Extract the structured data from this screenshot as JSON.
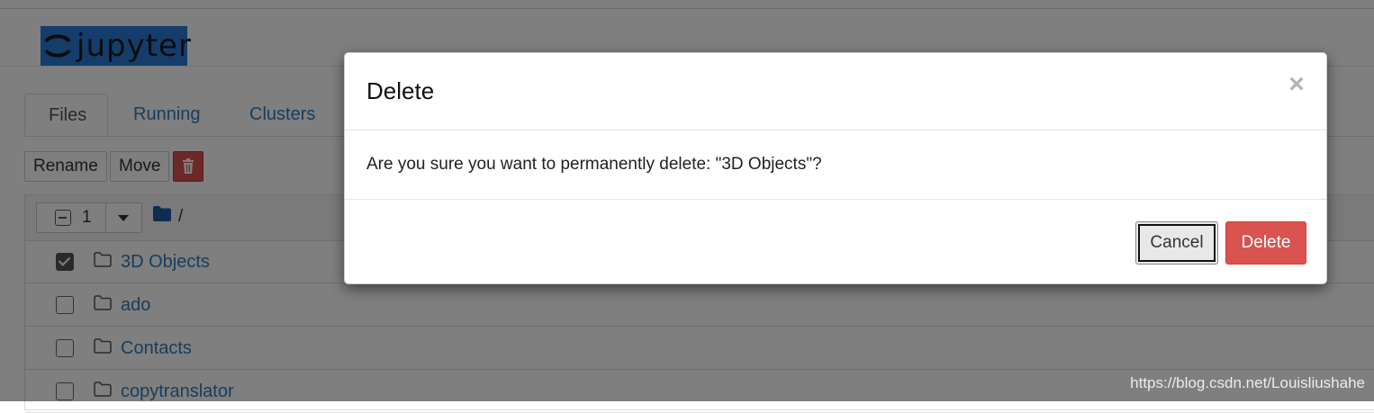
{
  "app": {
    "logo_text": "jupyter"
  },
  "tabs": [
    {
      "label": "Files",
      "active": true
    },
    {
      "label": "Running",
      "active": false
    },
    {
      "label": "Clusters",
      "active": false
    }
  ],
  "toolbar": {
    "rename_label": "Rename",
    "move_label": "Move",
    "trash_icon": "trash-icon"
  },
  "list_header": {
    "selected_count": "1",
    "path": "/"
  },
  "files": [
    {
      "name": "3D Objects",
      "checked": true
    },
    {
      "name": "ado",
      "checked": false
    },
    {
      "name": "Contacts",
      "checked": false
    },
    {
      "name": "copytranslator",
      "checked": false
    }
  ],
  "modal": {
    "title": "Delete",
    "close_glyph": "×",
    "message": "Are you sure you want to permanently delete: \"3D Objects\"?",
    "cancel_label": "Cancel",
    "delete_label": "Delete"
  },
  "watermark": "https://blog.csdn.net/Louisliushahe",
  "colors": {
    "link": "#337ab7",
    "danger": "#d9534f",
    "logo_bg": "#2b7bd8"
  }
}
